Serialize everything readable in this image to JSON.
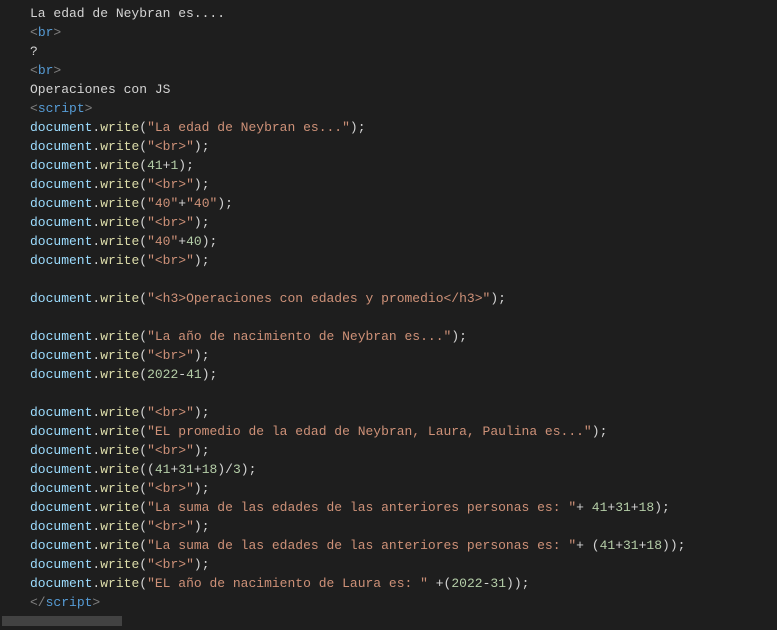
{
  "indent1": "    ",
  "indent2": "        ",
  "lines": {
    "l1_text": "La edad de Neybran es....",
    "l2_br_open": "<",
    "l2_br_tag": "br",
    "l2_br_close": ">",
    "l3_text": "?",
    "l4_br_open": "<",
    "l4_br_tag": "br",
    "l4_br_close": ">",
    "l5_text": "Operaciones con JS",
    "l6_open": "<",
    "l6_tag": "script",
    "l6_close": ">",
    "dw_obj": "document",
    "dw_dot": ".",
    "dw_fn": "write",
    "dw_lparen": "(",
    "dw_rparen": ")",
    "dw_semi": ";",
    "s1": "\"La edad de Neybran es...\"",
    "s_br": "\"<br>\"",
    "e1_a": "41",
    "plus": "+",
    "minus": "-",
    "slash": "/",
    "e1_b": "1",
    "s40": "\"40\"",
    "n40": "40",
    "s_h3": "\"<h3>Operaciones con edades y promedio</h3>\"",
    "s_anio": "\"La año de nacimiento de Neybran es...\"",
    "n2022": "2022",
    "n41": "41",
    "s_prom": "\"EL promedio de la edad de Neybran, Laura, Paulina es...\"",
    "open_p": "(",
    "close_p": ")",
    "open_pp": "((",
    "n31": "31",
    "n18": "18",
    "n3": "3",
    "s_suma": "\"La suma de las edades de las anteriores personas es: \"",
    "s_laura": "\"EL año de nacimiento de Laura es: \"",
    "close_tag_open": "</",
    "close_tag": "script",
    "close_tag_close": ">",
    "space": " "
  }
}
